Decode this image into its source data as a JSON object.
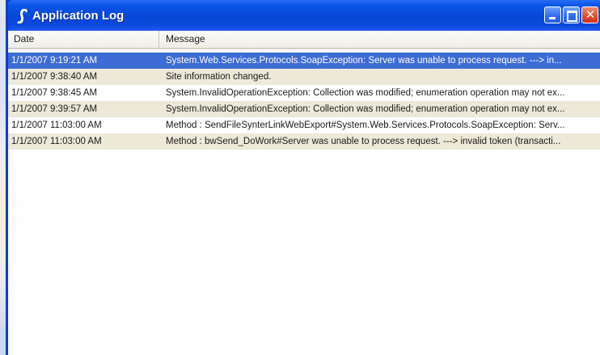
{
  "window": {
    "title": "Application Log",
    "accent_color": "#0a49dc",
    "close_color": "#e24a2a",
    "icons": {
      "app": "script-s-icon",
      "minimize": "minimize-icon",
      "maximize": "maximize-icon",
      "close": "close-icon"
    }
  },
  "grid": {
    "columns": [
      {
        "label": "Date"
      },
      {
        "label": "Message"
      }
    ],
    "selected_color": "#3d6cd2",
    "alt_row_color": "#ece9d8",
    "rows": [
      {
        "date": "1/1/2007 9:19:21 AM",
        "message": "System.Web.Services.Protocols.SoapException: Server was unable to process request. ---> in..."
      },
      {
        "date": "1/1/2007 9:38:40 AM",
        "message": "Site information changed."
      },
      {
        "date": "1/1/2007 9:38:45 AM",
        "message": "System.InvalidOperationException: Collection was modified; enumeration operation may not ex..."
      },
      {
        "date": "1/1/2007 9:39:57 AM",
        "message": "System.InvalidOperationException: Collection was modified; enumeration operation may not ex..."
      },
      {
        "date": "1/1/2007 11:03:00 AM",
        "message": "Method : SendFileSynterLinkWebExport#System.Web.Services.Protocols.SoapException: Serv..."
      },
      {
        "date": "1/1/2007 11:03:00 AM",
        "message": "Method : bwSend_DoWork#Server was unable to process request. ---> invalid token (transacti..."
      }
    ]
  }
}
